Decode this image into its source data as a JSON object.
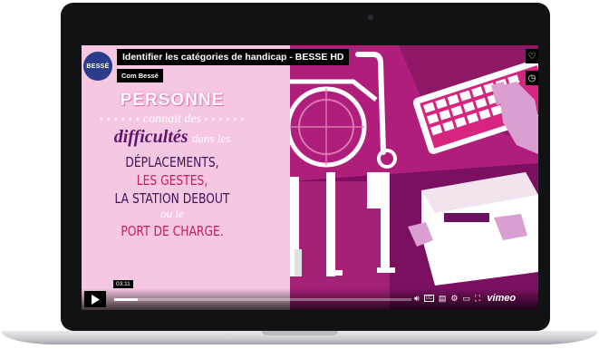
{
  "video": {
    "title": "Identifier les catégories de handicap - BESSE HD",
    "channel": "Com Bessé",
    "logo_text": "BESSÉ",
    "timestamp": "03:11",
    "progress": 0.08,
    "brand": "vimeo"
  },
  "slide": {
    "line1": "PERSONNE",
    "line2": "connait des",
    "line3": "difficultés",
    "line3b": "dans les",
    "line4": "DÉPLACEMENTS,",
    "line5": "LES GESTES,",
    "line6": "LA STATION DEBOUT",
    "line7": "ou le",
    "line8": "PORT DE CHARGE."
  },
  "colors": {
    "left_bg": "#f6c7e0",
    "scene_bg": "#b01e7c",
    "accent_red": "#c41f5a"
  },
  "icons": {
    "heart": "heart-icon",
    "clock": "clock-icon",
    "play": "play-icon",
    "volume": "volume-icon",
    "captions": "cc-icon",
    "transcript": "transcript-icon",
    "settings": "gear-icon",
    "pip": "pip-icon",
    "fullscreen": "fullscreen-icon"
  }
}
